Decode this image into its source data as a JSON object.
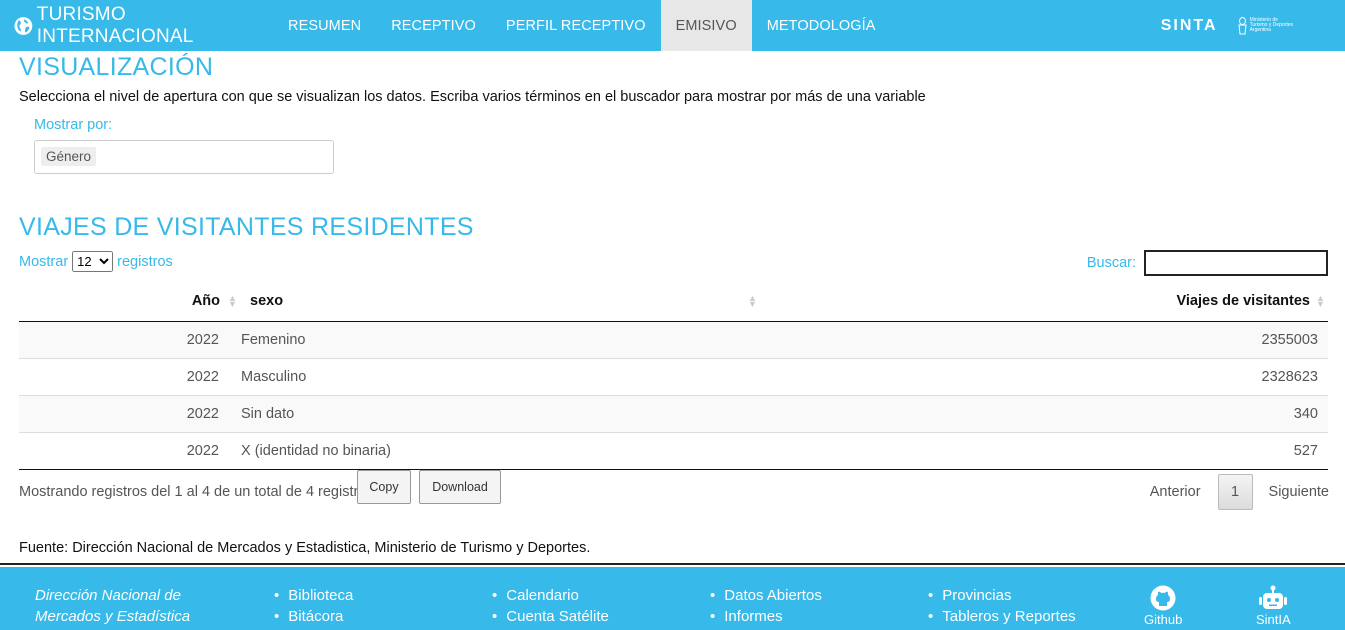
{
  "header": {
    "title": "TURISMO INTERNACIONAL",
    "nav": [
      {
        "label": "RESUMEN",
        "active": false
      },
      {
        "label": "RECEPTIVO",
        "active": false
      },
      {
        "label": "PERFIL RECEPTIVO",
        "active": false
      },
      {
        "label": "EMISIVO",
        "active": true
      },
      {
        "label": "METODOLOGÍA",
        "active": false
      }
    ],
    "brand_right": "SINTA",
    "ministerio_lines": [
      "Ministerio de",
      "Turismo y Deportes",
      "Argentina"
    ]
  },
  "visualizacion": {
    "title": "VISUALIZACIÓN",
    "description": "Selecciona el nivel de apertura con que se visualizan los datos. Escriba varios términos en el buscador para mostrar por más de una variable",
    "mostrar_label": "Mostrar por:",
    "selected_tag": "Género"
  },
  "table_section": {
    "title": "VIAJES DE VISITANTES RESIDENTES",
    "length_prefix": "Mostrar",
    "length_value": "12",
    "length_suffix": "registros",
    "search_label": "Buscar:",
    "search_value": "",
    "columns": [
      "Año",
      "sexo",
      "Viajes de visitantes"
    ],
    "rows": [
      {
        "anio": "2022",
        "sexo": "Femenino",
        "viajes": "2355003"
      },
      {
        "anio": "2022",
        "sexo": "Masculino",
        "viajes": "2328623"
      },
      {
        "anio": "2022",
        "sexo": "Sin dato",
        "viajes": "340"
      },
      {
        "anio": "2022",
        "sexo": "X (identidad no binaria)",
        "viajes": "527"
      }
    ],
    "info": "Mostrando registros del 1 al 4 de un total de 4 registros",
    "copy_label": "Copy",
    "download_label": "Download",
    "prev_label": "Anterior",
    "current_page": "1",
    "next_label": "Siguiente"
  },
  "fuente": "Fuente: Dirección Nacional de Mercados y Estadistica, Ministerio de Turismo y Deportes.",
  "footer": {
    "org_line1": "Dirección Nacional de",
    "org_line2": "Mercados y Estadística",
    "links": [
      [
        "Biblioteca",
        "Bitácora"
      ],
      [
        "Calendario",
        "Cuenta Satélite"
      ],
      [
        "Datos Abiertos",
        "Informes"
      ],
      [
        "Provincias",
        "Tableros y Reportes"
      ]
    ],
    "github_label": "Github",
    "sintia_label": "SintIA"
  },
  "colors": {
    "accent": "#37b9e9",
    "active_tab_bg": "#e7e7e7"
  },
  "icons": [
    "globe-icon",
    "sort-icon",
    "github-icon",
    "robot-icon",
    "ministerio-logo-icon"
  ]
}
